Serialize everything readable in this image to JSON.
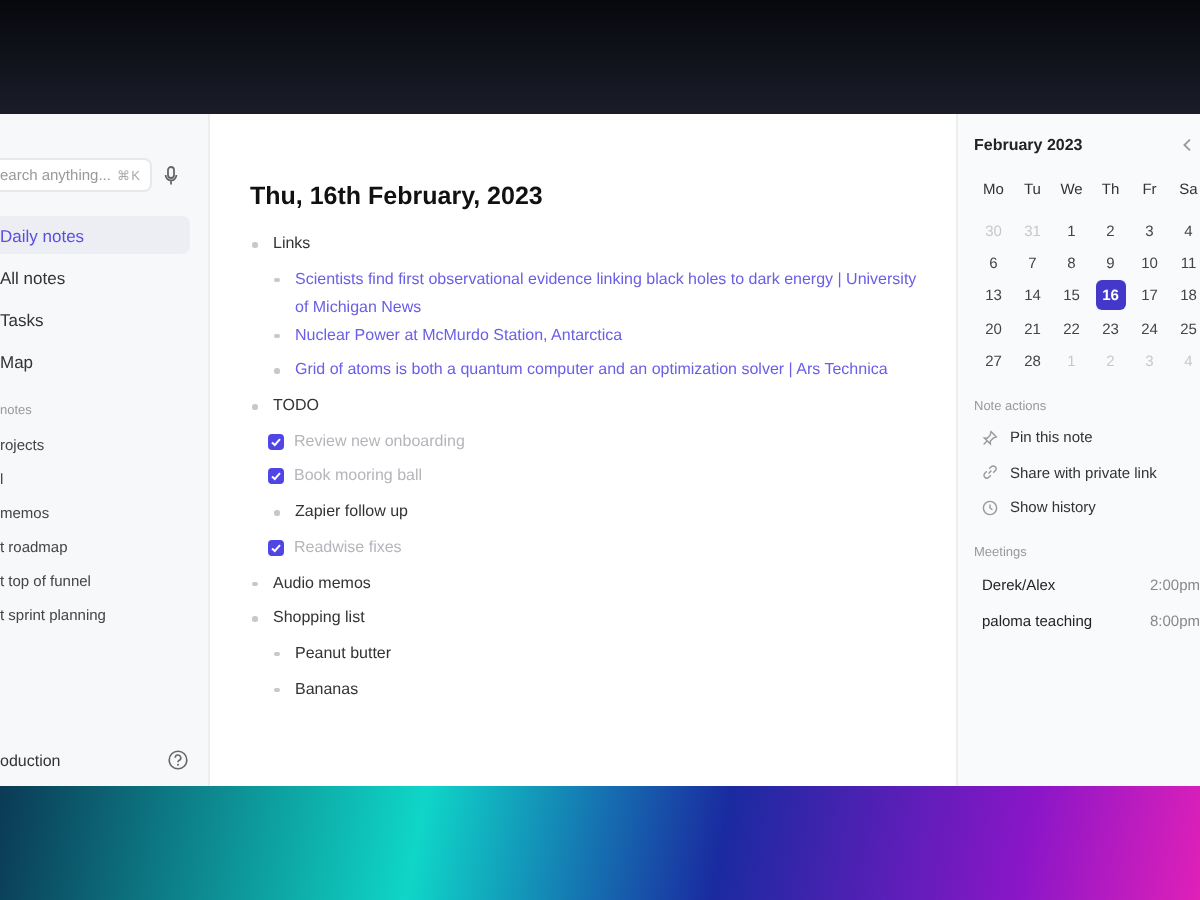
{
  "sidebar": {
    "search": {
      "placeholder": "earch anything...",
      "shortcut": "⌘K"
    },
    "nav": [
      {
        "label": "Daily notes",
        "selected": true
      },
      {
        "label": "All notes",
        "selected": false
      },
      {
        "label": "Tasks",
        "selected": false
      },
      {
        "label": "Map",
        "selected": false
      }
    ],
    "section_title": "notes",
    "notes": [
      "rojects",
      "l",
      "memos",
      "t roadmap",
      "t top of funnel",
      "t sprint planning"
    ],
    "footer": "oduction"
  },
  "note": {
    "title": "Thu, 16th February, 2023",
    "items": [
      {
        "kind": "bullet",
        "text": "Links",
        "children": [
          {
            "kind": "link",
            "text": "Scientists find first observational evidence linking black holes to dark energy | University of Michigan News"
          },
          {
            "kind": "link",
            "text": "Nuclear Power at McMurdo Station, Antarctica"
          },
          {
            "kind": "link",
            "text": "Grid of atoms is both a quantum computer and an optimization solver | Ars Technica"
          }
        ]
      },
      {
        "kind": "bullet",
        "text": "TODO",
        "children": [
          {
            "kind": "task",
            "text": "Review new onboarding",
            "checked": true
          },
          {
            "kind": "task",
            "text": "Book mooring ball",
            "checked": true
          },
          {
            "kind": "bullet",
            "text": "Zapier follow up"
          },
          {
            "kind": "task",
            "text": "Readwise fixes",
            "checked": true
          }
        ]
      },
      {
        "kind": "bullet",
        "text": "Audio memos"
      },
      {
        "kind": "bullet",
        "text": "Shopping list",
        "children": [
          {
            "kind": "bullet",
            "text": "Peanut butter"
          },
          {
            "kind": "bullet",
            "text": "Bananas"
          }
        ]
      }
    ]
  },
  "calendar": {
    "month": "February 2023",
    "weekdays": [
      "Mo",
      "Tu",
      "We",
      "Th",
      "Fr",
      "Sa"
    ],
    "days": [
      {
        "label": "30",
        "muted": true,
        "selected": false
      },
      {
        "label": "31",
        "muted": true,
        "selected": false
      },
      {
        "label": "1",
        "muted": false,
        "selected": false
      },
      {
        "label": "2",
        "muted": false,
        "selected": false
      },
      {
        "label": "3",
        "muted": false,
        "selected": false
      },
      {
        "label": "4",
        "muted": false,
        "selected": false
      },
      {
        "label": "6",
        "muted": false,
        "selected": false
      },
      {
        "label": "7",
        "muted": false,
        "selected": false
      },
      {
        "label": "8",
        "muted": false,
        "selected": false
      },
      {
        "label": "9",
        "muted": false,
        "selected": false
      },
      {
        "label": "10",
        "muted": false,
        "selected": false
      },
      {
        "label": "11",
        "muted": false,
        "selected": false
      },
      {
        "label": "13",
        "muted": false,
        "selected": false
      },
      {
        "label": "14",
        "muted": false,
        "selected": false
      },
      {
        "label": "15",
        "muted": false,
        "selected": false
      },
      {
        "label": "16",
        "muted": false,
        "selected": true
      },
      {
        "label": "17",
        "muted": false,
        "selected": false
      },
      {
        "label": "18",
        "muted": false,
        "selected": false
      },
      {
        "label": "20",
        "muted": false,
        "selected": false
      },
      {
        "label": "21",
        "muted": false,
        "selected": false
      },
      {
        "label": "22",
        "muted": false,
        "selected": false
      },
      {
        "label": "23",
        "muted": false,
        "selected": false
      },
      {
        "label": "24",
        "muted": false,
        "selected": false
      },
      {
        "label": "25",
        "muted": false,
        "selected": false
      },
      {
        "label": "27",
        "muted": false,
        "selected": false
      },
      {
        "label": "28",
        "muted": false,
        "selected": false
      },
      {
        "label": "1",
        "muted": true,
        "selected": false
      },
      {
        "label": "2",
        "muted": true,
        "selected": false
      },
      {
        "label": "3",
        "muted": true,
        "selected": false
      },
      {
        "label": "4",
        "muted": true,
        "selected": false
      }
    ]
  },
  "note_actions": {
    "title": "Note actions",
    "items": [
      "Pin this note",
      "Share with private link",
      "Show history"
    ]
  },
  "meetings": {
    "title": "Meetings",
    "items": [
      {
        "name": "Derek/Alex",
        "time": "2:00pm"
      },
      {
        "name": "paloma teaching",
        "time": "8:00pm"
      }
    ]
  }
}
